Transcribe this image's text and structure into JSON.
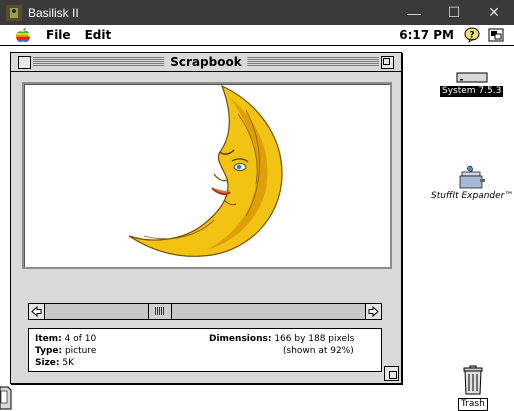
{
  "host": {
    "title": "Basilisk II",
    "minimize_glyph": "—",
    "maximize_glyph": "☐",
    "close_glyph": "✕"
  },
  "menubar": {
    "items": [
      "File",
      "Edit"
    ],
    "clock": "6:17 PM"
  },
  "scrapbook": {
    "title": "Scrapbook",
    "item_label": "Item:",
    "item_value": "4 of 10",
    "type_label": "Type:",
    "type_value": "picture",
    "size_label": "Size:",
    "size_value": "5K",
    "dimensions_label": "Dimensions:",
    "dimensions_value": "166 by 188 pixels",
    "shown_at": "(shown at 92%)",
    "scroll_position": 0.35
  },
  "desktop_icons": {
    "system": "System 7.5.3",
    "stuffit": "StuffIt Expander™",
    "trash": "Trash"
  },
  "colors": {
    "moon": "#f2c312",
    "moon_dark": "#c58a00",
    "host_bar": "#3a3a3a"
  }
}
